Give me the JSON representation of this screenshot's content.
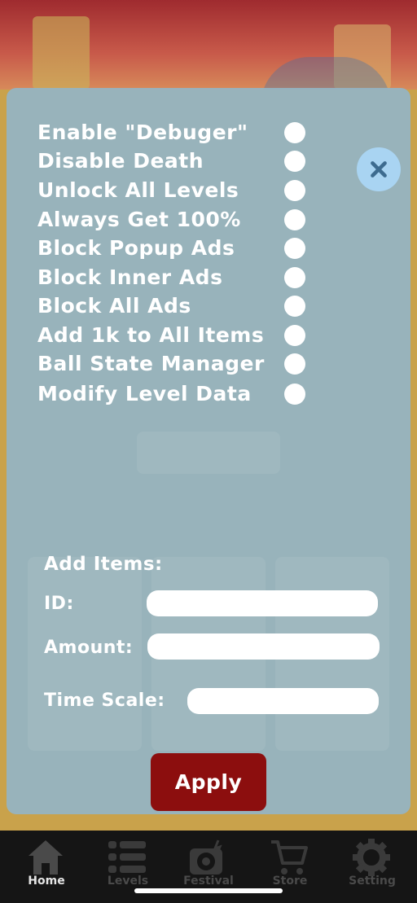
{
  "toggles": [
    {
      "label": "Enable \"Debuger\"",
      "on": false
    },
    {
      "label": "Disable Death",
      "on": false
    },
    {
      "label": "Unlock All Levels",
      "on": false
    },
    {
      "label": "Always Get 100%",
      "on": false
    },
    {
      "label": "Block Popup Ads",
      "on": false
    },
    {
      "label": "Block Inner Ads",
      "on": false
    },
    {
      "label": "Block All Ads",
      "on": false
    },
    {
      "label": "Add 1k to All Items",
      "on": false
    },
    {
      "label": "Ball State Manager",
      "on": false
    },
    {
      "label": "Modify Level Data",
      "on": false
    }
  ],
  "close_icon": "close-x-icon",
  "add_items": {
    "title": "Add Items:",
    "id_label": "ID:",
    "id_value": "",
    "amount_label": "Amount:",
    "amount_value": "",
    "time_scale_label": "Time Scale:",
    "time_scale_value": ""
  },
  "apply_label": "Apply",
  "colors": {
    "panel": "#94b4c4",
    "apply": "#8c0e0e",
    "close_bg": "#a9d4f2",
    "close_x": "#3d6b8f",
    "navbar": "#151515"
  },
  "nav": [
    {
      "label": "Home",
      "icon": "home-icon",
      "active": true
    },
    {
      "label": "Levels",
      "icon": "levels-list-icon",
      "active": false
    },
    {
      "label": "Festival",
      "icon": "festival-disc-icon",
      "active": false
    },
    {
      "label": "Store",
      "icon": "cart-icon",
      "active": false
    },
    {
      "label": "Setting",
      "icon": "gear-icon",
      "active": false
    }
  ]
}
